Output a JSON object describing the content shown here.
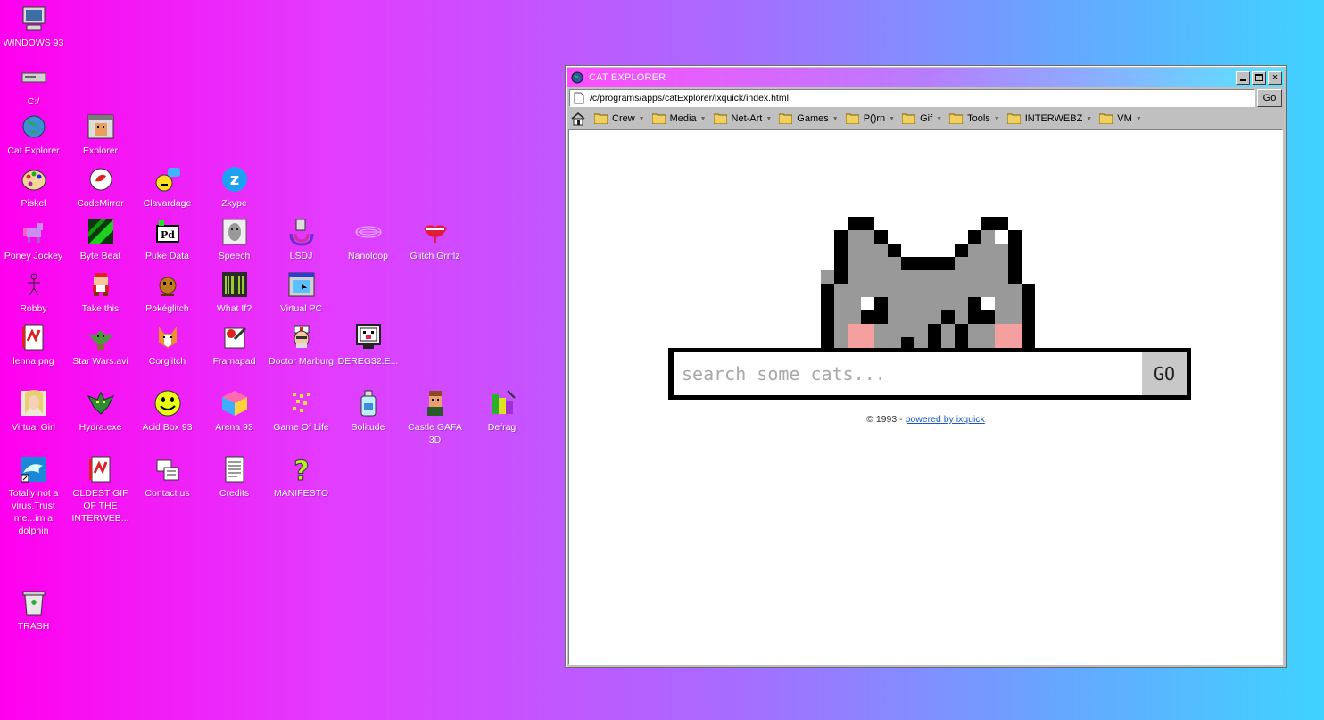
{
  "desktop": {
    "icons": [
      {
        "label": "WINDOWS 93",
        "icon": "computer-icon"
      },
      {
        "label": "C:/",
        "icon": "drive-icon"
      },
      {
        "label": "Cat Explorer",
        "icon": "globe-cat-icon"
      },
      {
        "label": "Explorer",
        "icon": "window-icon"
      },
      {
        "label": "Piskel",
        "icon": "palette-icon"
      },
      {
        "label": "CodeMirror",
        "icon": "codemirror-icon"
      },
      {
        "label": "Clavardage",
        "icon": "chat-icon"
      },
      {
        "label": "Zkype",
        "icon": "zkype-icon"
      },
      {
        "label": "Poney Jockey",
        "icon": "pony-icon"
      },
      {
        "label": "Byte Beat",
        "icon": "bytebeat-icon"
      },
      {
        "label": "Puke Data",
        "icon": "pd-icon"
      },
      {
        "label": "Speech",
        "icon": "speech-icon"
      },
      {
        "label": "LSDJ",
        "icon": "lsdj-icon"
      },
      {
        "label": "Nanoloop",
        "icon": "nanoloop-icon"
      },
      {
        "label": "Glitch Grrrlz",
        "icon": "lips-icon"
      },
      {
        "label": "Robby",
        "icon": "stickman-icon"
      },
      {
        "label": "Take this",
        "icon": "mario-icon"
      },
      {
        "label": "Pokéglitch",
        "icon": "pokeglitch-icon"
      },
      {
        "label": "What If?",
        "icon": "barcode-icon"
      },
      {
        "label": "Virtual PC",
        "icon": "virtualpc-icon"
      },
      {
        "label": "lenna.png",
        "icon": "image-file-icon"
      },
      {
        "label": "Star Wars.avi",
        "icon": "yoda-icon"
      },
      {
        "label": "Corglitch",
        "icon": "corgi-icon"
      },
      {
        "label": "Framapad",
        "icon": "notepad-icon"
      },
      {
        "label": "Doctor Marburg",
        "icon": "doctor-icon"
      },
      {
        "label": "DEREG32.E...",
        "icon": "monitor-face-icon"
      },
      {
        "label": "Virtual Girl",
        "icon": "girl-icon"
      },
      {
        "label": "Hydra.exe",
        "icon": "hydra-icon"
      },
      {
        "label": "Acid Box 93",
        "icon": "smiley-icon"
      },
      {
        "label": "Arena 93",
        "icon": "cube-icon"
      },
      {
        "label": "Game Of Life",
        "icon": "life-icon"
      },
      {
        "label": "Solitude",
        "icon": "bottle-icon"
      },
      {
        "label": "Castle GAFA 3D",
        "icon": "castle-guy-icon"
      },
      {
        "label": "Defrag",
        "icon": "defrag-icon"
      },
      {
        "label": "Totally not a virus.Trust me...im a dolphin",
        "icon": "dolphin-icon"
      },
      {
        "label": "OLDEST GIF OF THE INTERWEB...",
        "icon": "gif-file-icon"
      },
      {
        "label": "Contact us",
        "icon": "contact-icon"
      },
      {
        "label": "Credits",
        "icon": "document-icon"
      },
      {
        "label": "MANIFESTO",
        "icon": "question-icon"
      },
      {
        "label": "TRASH",
        "icon": "trash-icon"
      }
    ]
  },
  "window": {
    "title": "CAT EXPLORER",
    "address": "/c/programs/apps/catExplorer/ixquick/index.html",
    "go_label": "Go",
    "bookmarks": [
      "Crew",
      "Media",
      "Net-Art",
      "Games",
      "P()rn",
      "Gif",
      "Tools",
      "INTERWEBZ",
      "VM"
    ],
    "search": {
      "placeholder": "search some cats...",
      "go_label": "GO"
    },
    "footer": {
      "copyright": "© 1993 - ",
      "link_text": "powered by ixquick"
    }
  }
}
